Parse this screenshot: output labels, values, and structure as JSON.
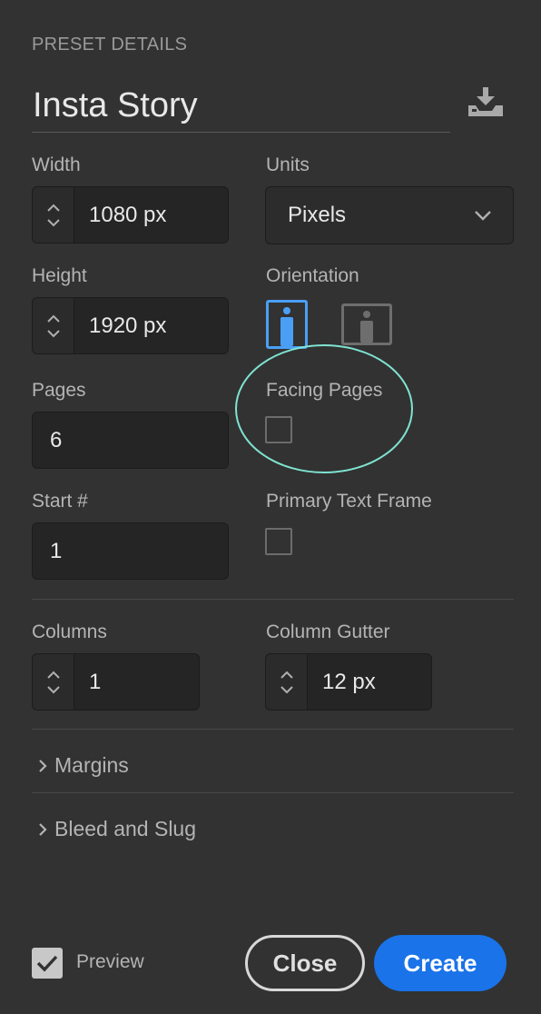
{
  "panel": {
    "section_title": "PRESET DETAILS",
    "preset_name": "Insta Story"
  },
  "fields": {
    "width_label": "Width",
    "width_value": "1080 px",
    "units_label": "Units",
    "units_value": "Pixels",
    "height_label": "Height",
    "height_value": "1920 px",
    "orientation_label": "Orientation",
    "pages_label": "Pages",
    "pages_value": "6",
    "facing_pages_label": "Facing Pages",
    "facing_pages_checked": false,
    "start_label": "Start #",
    "start_value": "1",
    "primary_text_frame_label": "Primary Text Frame",
    "primary_text_frame_checked": false,
    "columns_label": "Columns",
    "columns_value": "1",
    "gutter_label": "Column Gutter",
    "gutter_value": "12 px"
  },
  "orientation": {
    "selected": "portrait",
    "options": [
      "portrait-icon",
      "landscape-icon"
    ]
  },
  "sections": {
    "margins": "Margins",
    "bleed": "Bleed and Slug"
  },
  "footer": {
    "preview_label": "Preview",
    "preview_checked": true,
    "close_label": "Close",
    "create_label": "Create"
  },
  "colors": {
    "background": "#323232",
    "accent": "#1a73e8",
    "portrait_selected": "#4a9ff5",
    "annotation_circle": "#7fe3d1"
  }
}
